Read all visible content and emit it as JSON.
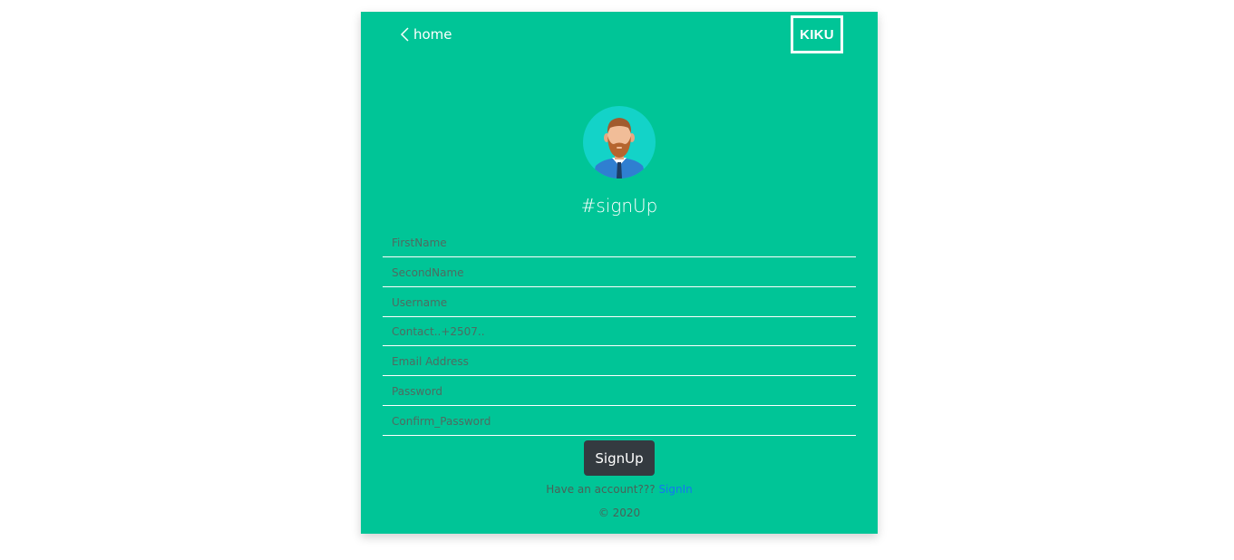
{
  "header": {
    "home_label": "home",
    "logo_text": "KIKU"
  },
  "form": {
    "title": "#signUp",
    "fields": [
      {
        "placeholder": "FirstName",
        "value": ""
      },
      {
        "placeholder": "SecondName",
        "value": ""
      },
      {
        "placeholder": "Username",
        "value": ""
      },
      {
        "placeholder": "Contact..+2507..",
        "value": ""
      },
      {
        "placeholder": "Email Address",
        "value": ""
      },
      {
        "placeholder": "Password",
        "value": ""
      },
      {
        "placeholder": "Confirm_Password",
        "value": ""
      }
    ],
    "submit_label": "SignUp"
  },
  "footer": {
    "have_account_text": "Have an account???",
    "signin_label": "SignIn",
    "copyright": "© 2020"
  },
  "colors": {
    "card_background": "#00c597",
    "button_background": "#343a40",
    "link": "#1477f0"
  },
  "icons": {
    "back": "chevron-left-icon",
    "avatar": "bearded-man-avatar"
  }
}
